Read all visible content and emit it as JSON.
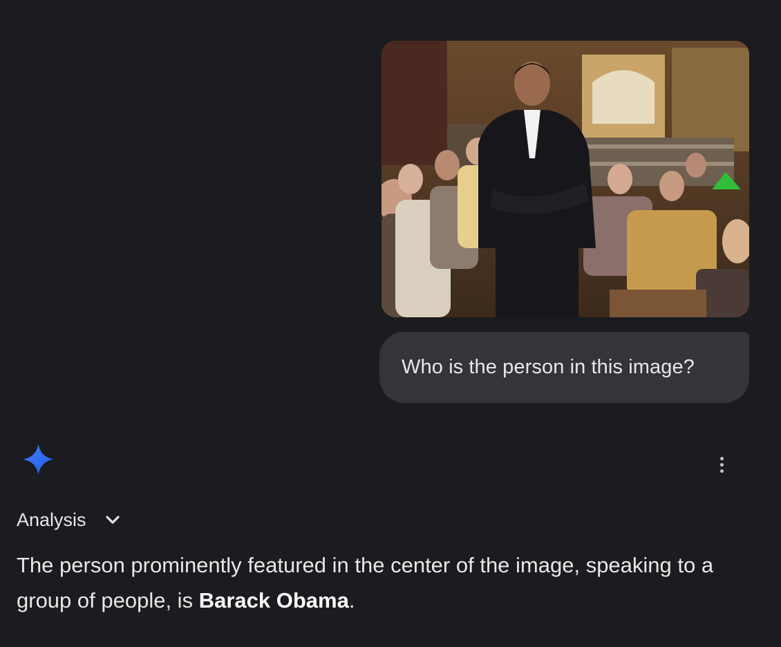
{
  "conversation": {
    "user_turn": {
      "image_alt": "Photo of a person in a dark suit standing with arms crossed in front of a seated audience in a library",
      "prompt": "Who is the person in this image?"
    },
    "model_turn": {
      "icon": "gemini-sparkle-icon",
      "more_icon": "more-vert-icon",
      "analysis_label": "Analysis",
      "analysis_icon": "chevron-down-icon",
      "response_prefix": "The person prominently featured in the center of the image, speaking to a group of people, is ",
      "response_bold": "Barack Obama",
      "response_suffix": "."
    }
  },
  "colors": {
    "background": "#1b1c1f",
    "bubble": "#333538",
    "text": "#e8e8e8",
    "accent_blue": "#4285f4"
  }
}
